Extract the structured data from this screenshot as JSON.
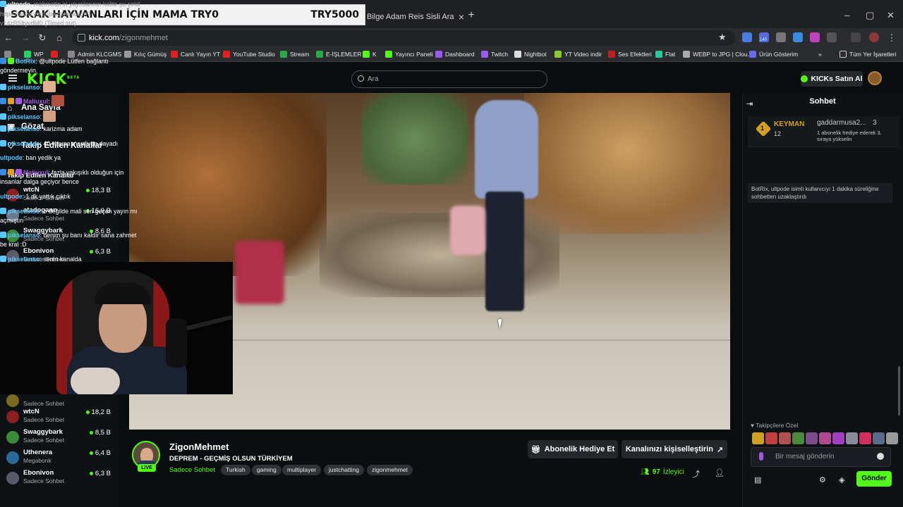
{
  "overlay": {
    "left_text": "SOKAK HAYVANLARI İÇİN MAMA  TRY0",
    "right_text": "TRY5000"
  },
  "browser": {
    "tab_title": "Bilge Adam Reis Sisli Arazide Ç",
    "url_domain": "kick.com",
    "url_path": "/zigonmehmet",
    "bookmarks": [
      "WP",
      "",
      "Admin KLCGMS",
      "Kılıç Gümüş",
      "Canlı Yayın YT",
      "YouTube Studio",
      "Stream",
      "E-İŞLEMLER",
      "K",
      "Yayıncı Paneli",
      "Dashboard",
      "Twitch",
      "Nightbot",
      "YT Video indir",
      "Ses Efektleri",
      "Flat",
      "WEBP to JPG | Clou...",
      "Ürün Gösterim"
    ],
    "all_bookmarks": "Tüm Yer İşaretleri",
    "ext_badge": "140"
  },
  "header": {
    "logo": "KICK",
    "logo_beta": "BETA",
    "search_placeholder": "Ara",
    "kicks_button": "KICKs Satın Al"
  },
  "sidebar": {
    "nav": [
      {
        "label": "Ana Sayfa"
      },
      {
        "label": "Gözat"
      },
      {
        "label": "Takip Edilen Kanallar"
      }
    ],
    "section_title": "Takip Edilen Kanallar",
    "channels": [
      {
        "name": "wtcN",
        "status": "Sadece Sohbet",
        "viewers": "18,3 B"
      },
      {
        "name": "atadogann",
        "status": "Sadece Sohbet",
        "viewers": "16,9 B"
      },
      {
        "name": "Swaggybark",
        "status": "Sadece Sohbet",
        "viewers": "8,6 B"
      },
      {
        "name": "Ebonivon",
        "status": "Sadece Sohbet",
        "viewers": "6,3 B"
      }
    ],
    "channels_lower": [
      {
        "name": "",
        "status": "Sadece Sohbet",
        "viewers": ""
      },
      {
        "name": "wtcN",
        "status": "Sadece Sohbet",
        "viewers": "18,2 B"
      },
      {
        "name": "Swaggybark",
        "status": "Sadece Sohbet",
        "viewers": "8,5 B"
      },
      {
        "name": "Uthenera",
        "status": "Megabonk",
        "viewers": "6,4 B"
      },
      {
        "name": "Ebonivon",
        "status": "Sadece Sohbet",
        "viewers": "6,3 B"
      }
    ]
  },
  "stream": {
    "name": "ZigonMehmet",
    "title": "DEPREM - GEÇMİŞ OLSUN TÜRKİYEM",
    "category": "Sadece Sohbet",
    "live": "LIVE",
    "tags": [
      "Turkish",
      "gaming",
      "multiplayer",
      "justchatting",
      "zigonmehmet"
    ],
    "gift_button": "Abonelik Hediye Et",
    "customize_button": "Kanalınızı kişiselleştirin",
    "viewers_count": "97",
    "viewers_label": "İzleyici"
  },
  "chat": {
    "title": "Sohbet",
    "pinned": {
      "rank": "1",
      "king_name": "KEYMAN",
      "king_count": "12",
      "gifter": "gaddarmusa2...",
      "gifter_count": "3",
      "gifter_text": "1 abonelik hediye ederek 3. sıraya yükselin"
    },
    "messages": [
      {
        "user": "ultpode",
        "color": "#e8eaed",
        "text": " mehmetin iri yayınlarının kalite şu şekil "
      },
      {
        "user": "",
        "color": "#e8eaed",
        "text": "https://www.youtube.com/watch?"
      },
      {
        "user": "",
        "color": "#e8eaed",
        "text": "v=4zR5ftyvdM0 (Timed out)"
      },
      {
        "user": "BotRix",
        "color": "#5bc6ff",
        "text": " @ultpode Lütfen bağlantı göndermeyin."
      },
      {
        "user": "pikselanso",
        "color": "#5bc6ff",
        "text": ""
      },
      {
        "user": "Maliuxul",
        "color": "#a35ae0",
        "text": ""
      },
      {
        "user": "pikselanso",
        "color": "#5bc6ff",
        "text": ""
      },
      {
        "user": "pikselanso",
        "color": "#5bc6ff",
        "text": " karizma adam"
      },
      {
        "user": "pikselanso",
        "color": "#5bc6ff",
        "text": " 40 yaşına merdiven dayadı"
      },
      {
        "user": "ultpode",
        "color": "#5bc6ff",
        "text": " ban yedik ya"
      },
      {
        "user": "Maliuxul",
        "color": "#a35ae0",
        "text": " fazla yakışıklı olduğun için insanlar dalga geçiyor bence"
      },
      {
        "user": "ultpode",
        "color": "#5bc6ff",
        "text": " 1 dk yattık çıktık"
      },
      {
        "user": "pikselanso",
        "color": "#5bc6ff",
        "text": " o değilde mali sen geçen yayın mı açmıştın"
      },
      {
        "user": "pikselanso",
        "color": "#5bc6ff",
        "text": " benim şu banı kaldır sana zahmet be kral :D"
      },
      {
        "user": "pikselanso",
        "color": "#5bc6ff",
        "text": " senin kanalda"
      }
    ],
    "system_msg": "BotRix, ultpode isimli kullanıcıyı 1 dakika süreliğine sohbetten uzaklaştırdı",
    "follower_only": "Takipçilere Özel",
    "input_placeholder": "Bir mesaj gönderin",
    "send_button": "Gönder"
  }
}
